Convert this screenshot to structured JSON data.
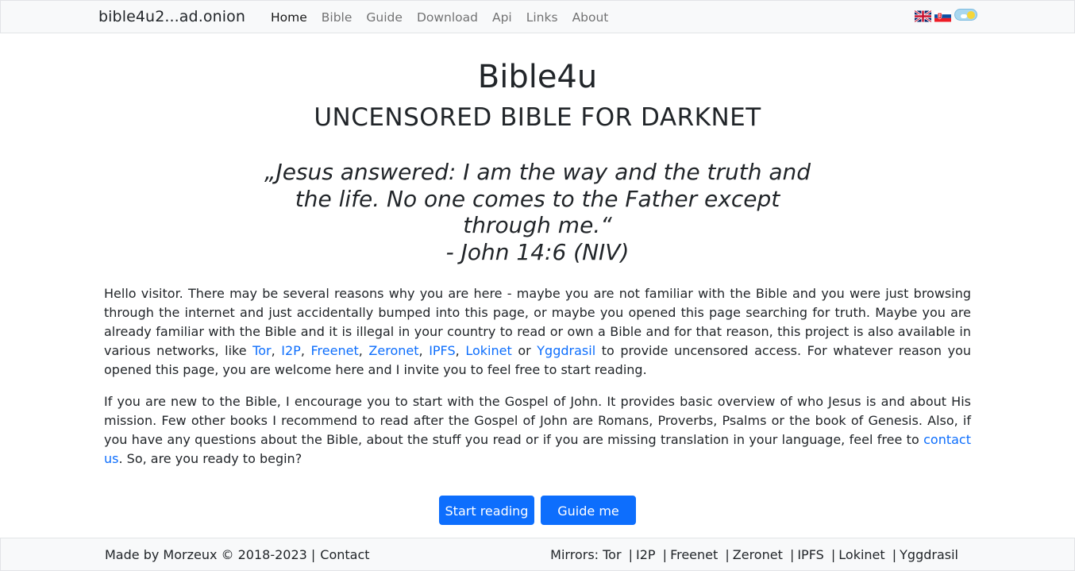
{
  "navbar": {
    "brand": "bible4u2...ad.onion",
    "items": [
      {
        "label": "Home",
        "active": true
      },
      {
        "label": "Bible"
      },
      {
        "label": "Guide"
      },
      {
        "label": "Download"
      },
      {
        "label": "Api"
      },
      {
        "label": "Links"
      },
      {
        "label": "About"
      }
    ],
    "flags": [
      "uk-flag-icon",
      "slovak-flag-icon"
    ],
    "theme_toggle_icon": "sun-cloud-toggle-icon"
  },
  "hero": {
    "title": "Bible4u",
    "subtitle": "UNCENSORED BIBLE FOR DARKNET",
    "quote_lines": [
      "„Jesus answered: I am the way and the truth and",
      "the life. No one comes to the Father except",
      "through me.“",
      "- John 14:6 (NIV)"
    ]
  },
  "intro": {
    "p1_a": "Hello visitor. There may be several reasons why you are here - maybe you are not familiar with the Bible and you were just browsing through the internet and just accidentally bumped into this page, or maybe you opened this page searching for truth. Maybe you are already familiar with the Bible and it is illegal in your country to read or own a Bible and for that reason, this project is also available in various networks, like ",
    "links": [
      "Tor",
      "I2P",
      "Freenet",
      "Zeronet",
      "IPFS",
      "Lokinet",
      "Yggdrasil"
    ],
    "comma": ", ",
    "or": " or ",
    "p1_b": " to provide uncensored access. For whatever reason you opened this page, you are welcome here and I invite you to feel free to start reading.",
    "p2_a": "If you are new to the Bible, I encourage you to start with the Gospel of John. It provides basic overview of who Jesus is and about His mission. Few other books I recommend to read after the Gospel of John are Romans, Proverbs, Psalms or the book of Genesis. Also, if you have any questions about the Bible, about the stuff you read or if you are missing translation in your language, feel free to ",
    "contact_link": "contact us",
    "p2_b": ". So, are you ready to begin?"
  },
  "buttons": {
    "start": "Start reading",
    "guide": "Guide me"
  },
  "footer": {
    "made_by": "Made by Morzeux © 2018-2023 |",
    "contact": "Contact",
    "mirrors_label": "Mirrors: ",
    "mirrors": [
      "Tor",
      "I2P",
      "Freenet",
      "Zeronet",
      "IPFS",
      "Lokinet",
      "Yggdrasil"
    ],
    "separator": "|"
  },
  "colors": {
    "link": "#0d6efd",
    "button_bg": "#0d6efd",
    "navbar_bg": "#f8f9fa"
  }
}
